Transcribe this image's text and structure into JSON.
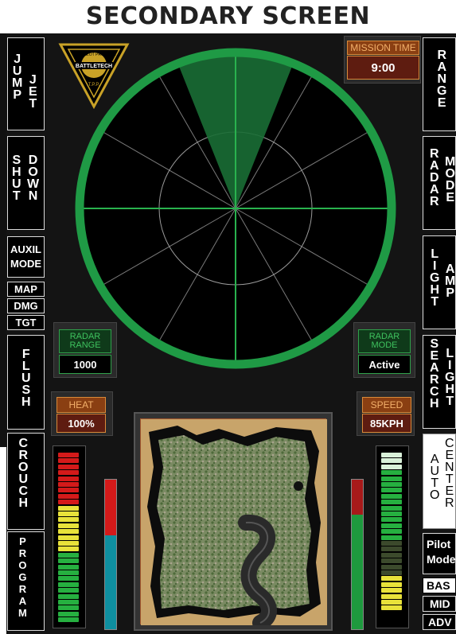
{
  "title": "SECONDARY SCREEN",
  "left_buttons": {
    "jump_jet": {
      "col1": [
        "J",
        "U",
        "M",
        "P"
      ],
      "col2": [
        "J",
        "E",
        "T"
      ]
    },
    "shutdown": {
      "col1": [
        "S",
        "H",
        "U",
        "T"
      ],
      "col2": [
        "D",
        "O",
        "W",
        "N"
      ]
    },
    "auxil_mode": "AUXIL MODE",
    "map": "MAP",
    "dmg": "DMG",
    "tgt": "TGT",
    "flush": [
      "F",
      "L",
      "U",
      "S",
      "H"
    ],
    "crouch": [
      "C",
      "R",
      "O",
      "U",
      "C",
      "H"
    ],
    "program": [
      "P",
      "R",
      "O",
      "G",
      "R",
      "A",
      "M"
    ]
  },
  "right_buttons": {
    "range": [
      "R",
      "A",
      "N",
      "G",
      "E"
    ],
    "radar_mode": {
      "col1": [
        "R",
        "A",
        "D",
        "A",
        "R"
      ],
      "col2": [
        "M",
        "O",
        "D",
        "E"
      ]
    },
    "light_amp": {
      "col1": [
        "L",
        "I",
        "G",
        "H",
        "T"
      ],
      "col2": [
        "A",
        "M",
        "P"
      ]
    },
    "search_light": {
      "col1": [
        "S",
        "E",
        "A",
        "R",
        "C",
        "H"
      ],
      "col2": [
        "L",
        "I",
        "G",
        "H",
        "T"
      ]
    },
    "auto_center": {
      "col1": [
        "A",
        "U",
        "T",
        "O"
      ],
      "col2": [
        "C",
        "E",
        "N",
        "T",
        "E",
        "R"
      ]
    },
    "pilot_mode": "Pilot Mode",
    "basic": "BAS",
    "mid": "MID",
    "adv": "ADV"
  },
  "mission_time": {
    "label": "MISSION TIME",
    "value": "9:00"
  },
  "radar_range": {
    "label": "RADAR RANGE",
    "value": "1000"
  },
  "radar_mode": {
    "label": "RADAR MODE",
    "value": "Active"
  },
  "heat": {
    "label": "HEAT",
    "value": "100%"
  },
  "speed": {
    "label": "SPEED",
    "value": "85KPH"
  },
  "heat_bar": {
    "level": 0.63
  },
  "speed_bar": {
    "level": 0.77
  },
  "heat_meter": {
    "red_segments": 9,
    "yellow_segments": 8,
    "green_segments": 12
  },
  "speed_meter": {
    "white_segments": 3,
    "green_segments": 12,
    "dark_segments": 6,
    "yellow_segments": 6
  },
  "logo": {
    "text_top": "TEST PILOT PROGRAM",
    "text_mid": "BATTLETECH",
    "text_bottom": "T.P.P."
  },
  "colors": {
    "radar_green": "#1f9a45",
    "scope_bg": "#000000",
    "panel_bg": "#141414",
    "heat_red": "#d41a1a",
    "meter_yellow": "#e8e23a"
  }
}
